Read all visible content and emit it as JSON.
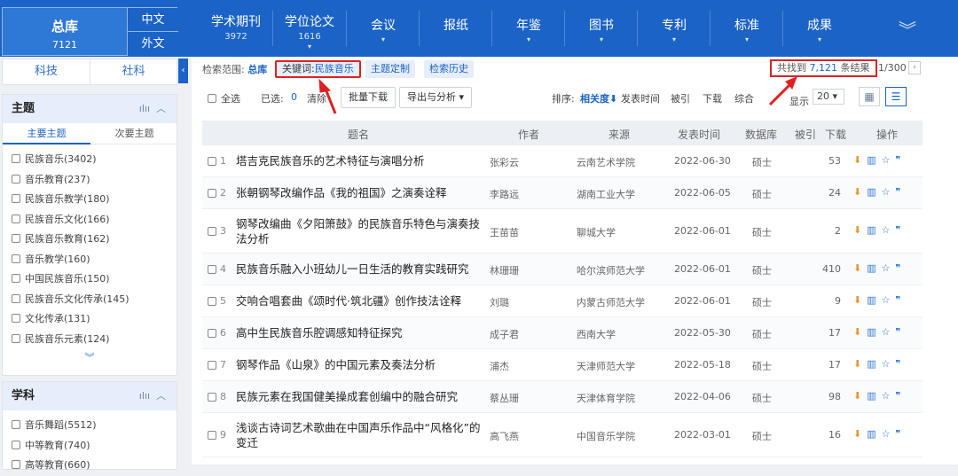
{
  "header": {
    "total_title": "总库",
    "total_count": "7121",
    "lang_zh": "中文",
    "lang_en": "外文",
    "nav": [
      {
        "label": "学术期刊",
        "count": "3972",
        "chevron": ""
      },
      {
        "label": "学位论文",
        "count": "1616",
        "chevron": "▾"
      },
      {
        "label": "会议",
        "count": "",
        "chevron": "▾"
      },
      {
        "label": "报纸",
        "count": "",
        "chevron": ""
      },
      {
        "label": "年鉴",
        "count": "",
        "chevron": "▾"
      },
      {
        "label": "图书",
        "count": "",
        "chevron": "▾"
      },
      {
        "label": "专利",
        "count": "",
        "chevron": "▾"
      },
      {
        "label": "标准",
        "count": "",
        "chevron": "▾"
      },
      {
        "label": "成果",
        "count": "",
        "chevron": "▾"
      }
    ],
    "expand_icon": "double-chevron-down-icon"
  },
  "sidebar": {
    "tabs": [
      "科技",
      "社科"
    ],
    "topic_panel": {
      "title": "主题",
      "subtabs": [
        "主要主题",
        "次要主题"
      ],
      "items": [
        "民族音乐(3402)",
        "音乐教育(237)",
        "民族音乐教学(180)",
        "民族音乐文化(166)",
        "民族音乐教育(162)",
        "音乐教学(160)",
        "中国民族音乐(150)",
        "民族音乐文化传承(145)",
        "文化传承(131)",
        "民族音乐元素(124)"
      ],
      "more": "︾"
    },
    "subject_panel": {
      "title": "学科",
      "items": [
        "音乐舞蹈(5512)",
        "中等教育(740)",
        "高等教育(660)"
      ]
    }
  },
  "main": {
    "scope_label": "检索范围:",
    "scope_value": "总库",
    "keyword_label": "关键词:",
    "keyword_value": "民族音乐",
    "theme_btn": "主题定制",
    "history_btn": "检索历史",
    "found_prefix": "共找到",
    "found_count": "7,121",
    "found_suffix": "条结果",
    "page": "1/300",
    "toolbar": {
      "select_all": "全选",
      "selected_label": "已选:",
      "selected_count": "0",
      "clear": "清除",
      "batch_download": "批量下载",
      "export": "导出与分析 ▾",
      "sort_label": "排序:",
      "sort_relevance": "相关度",
      "sort_date": "发表时间",
      "sort_cited": "被引",
      "sort_download": "下载",
      "sort_comprehensive": "综合",
      "display_label": "显示",
      "display_value": "20 ▾"
    },
    "columns": [
      "题名",
      "作者",
      "来源",
      "发表时间",
      "数据库",
      "被引",
      "下载",
      "操作"
    ],
    "rows": [
      {
        "no": "1",
        "title": "塔吉克民族音乐的艺术特征与演唱分析",
        "author": "张彩云",
        "source": "云南艺术学院",
        "date": "2022-06-30",
        "db": "硕士",
        "cited": "",
        "downloads": "53"
      },
      {
        "no": "2",
        "title": "张朝钢琴改编作品《我的祖国》之演奏诠释",
        "author": "李路远",
        "source": "湖南工业大学",
        "date": "2022-06-05",
        "db": "硕士",
        "cited": "",
        "downloads": "24"
      },
      {
        "no": "3",
        "title": "钢琴改编曲《夕阳箫鼓》的民族音乐特色与演奏技法分析",
        "author": "王苗苗",
        "source": "聊城大学",
        "date": "2022-06-01",
        "db": "硕士",
        "cited": "",
        "downloads": "2"
      },
      {
        "no": "4",
        "title": "民族音乐融入小班幼儿一日生活的教育实践研究",
        "author": "林珊珊",
        "source": "哈尔滨师范大学",
        "date": "2022-06-01",
        "db": "硕士",
        "cited": "",
        "downloads": "410"
      },
      {
        "no": "5",
        "title": "交响合唱套曲《颂时代·筑北疆》创作技法诠释",
        "author": "刘璐",
        "source": "内蒙古师范大学",
        "date": "2022-06-01",
        "db": "硕士",
        "cited": "",
        "downloads": "9"
      },
      {
        "no": "6",
        "title": "高中生民族音乐腔调感知特征探究",
        "author": "成子君",
        "source": "西南大学",
        "date": "2022-05-30",
        "db": "硕士",
        "cited": "",
        "downloads": "17"
      },
      {
        "no": "7",
        "title": "钢琴作品《山泉》的中国元素及奏法分析",
        "author": "浦杰",
        "source": "天津师范大学",
        "date": "2022-05-18",
        "db": "硕士",
        "cited": "",
        "downloads": "17"
      },
      {
        "no": "8",
        "title": "民族元素在我国健美操成套创编中的融合研究",
        "author": "蔡丛珊",
        "source": "天津体育学院",
        "date": "2022-04-06",
        "db": "硕士",
        "cited": "",
        "downloads": "98"
      },
      {
        "no": "9",
        "title": "浅谈古诗词艺术歌曲在中国声乐作品中“风格化”的变迁",
        "author": "高飞燕",
        "source": "中国音乐学院",
        "date": "2022-03-01",
        "db": "硕士",
        "cited": "",
        "downloads": "16"
      }
    ],
    "op_icons": [
      "download-icon",
      "read-icon",
      "favorite-icon",
      "cite-icon"
    ]
  },
  "colors": {
    "nav_blue": "#1b63c6",
    "accent_blue": "#2e78d6",
    "highlight_red": "#e02020",
    "download_orange": "#e8962a"
  }
}
